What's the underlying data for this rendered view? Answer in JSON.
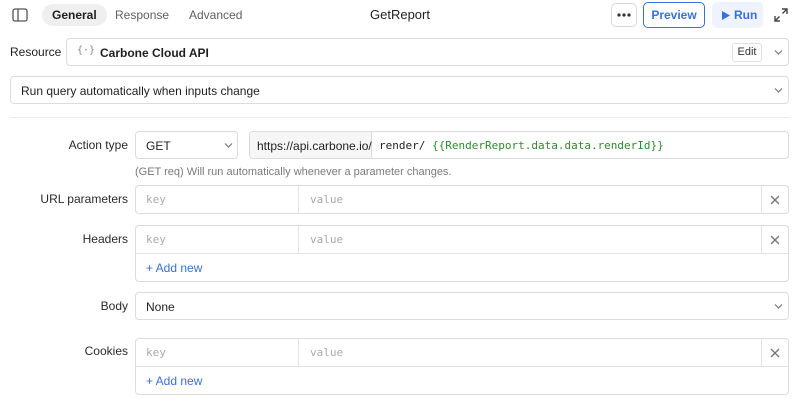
{
  "toolbar": {
    "tabs": [
      "General",
      "Response",
      "Advanced"
    ],
    "query_name": "GetReport",
    "preview_label": "Preview",
    "run_label": "Run"
  },
  "resource": {
    "label": "Resource",
    "value": "Carbone Cloud API",
    "edit_label": "Edit"
  },
  "run_mode": {
    "value": "Run query automatically when inputs change"
  },
  "action": {
    "label": "Action type",
    "method": "GET",
    "base_url": "https://api.carbone.io/",
    "path_prefix": "render/",
    "path_template": "{{RenderReport.data.data.renderId}}",
    "hint": "(GET req) Will run automatically whenever a parameter changes."
  },
  "url_params": {
    "label": "URL parameters",
    "key_placeholder": "key",
    "value_placeholder": "value"
  },
  "headers": {
    "label": "Headers",
    "key_placeholder": "key",
    "value_placeholder": "value",
    "add_label": "+ Add new"
  },
  "body": {
    "label": "Body",
    "value": "None"
  },
  "cookies": {
    "label": "Cookies",
    "key_placeholder": "key",
    "value_placeholder": "value",
    "add_label": "+ Add new"
  },
  "colors": {
    "accent": "#3a6fe0",
    "template_green": "#2e8b2e"
  }
}
